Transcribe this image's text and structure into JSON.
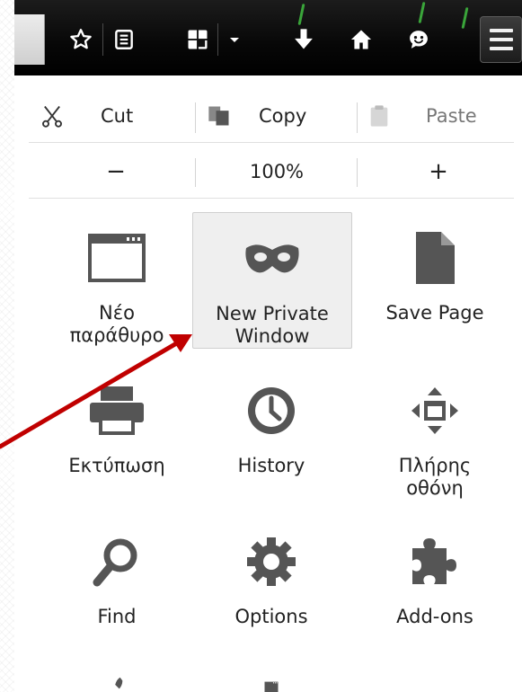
{
  "edit": {
    "cut_label": "Cut",
    "copy_label": "Copy",
    "paste_label": "Paste"
  },
  "zoom": {
    "out_label": "−",
    "level": "100%",
    "in_label": "+"
  },
  "tiles": [
    {
      "label": "Νέο\nπαράθυρο",
      "icon": "new-window-icon"
    },
    {
      "label": "New Private\nWindow",
      "icon": "private-mask-icon"
    },
    {
      "label": "Save Page",
      "icon": "save-page-icon"
    },
    {
      "label": "Εκτύπωση",
      "icon": "printer-icon"
    },
    {
      "label": "History",
      "icon": "clock-icon"
    },
    {
      "label": "Πλήρης\nοθόνη",
      "icon": "fullscreen-icon"
    },
    {
      "label": "Find",
      "icon": "magnifier-icon"
    },
    {
      "label": "Options",
      "icon": "gear-icon"
    },
    {
      "label": "Add-ons",
      "icon": "puzzle-icon"
    }
  ],
  "colors": {
    "icon": "#555555",
    "arrow": "#c00000",
    "toolbar": "#0a0a0a"
  }
}
